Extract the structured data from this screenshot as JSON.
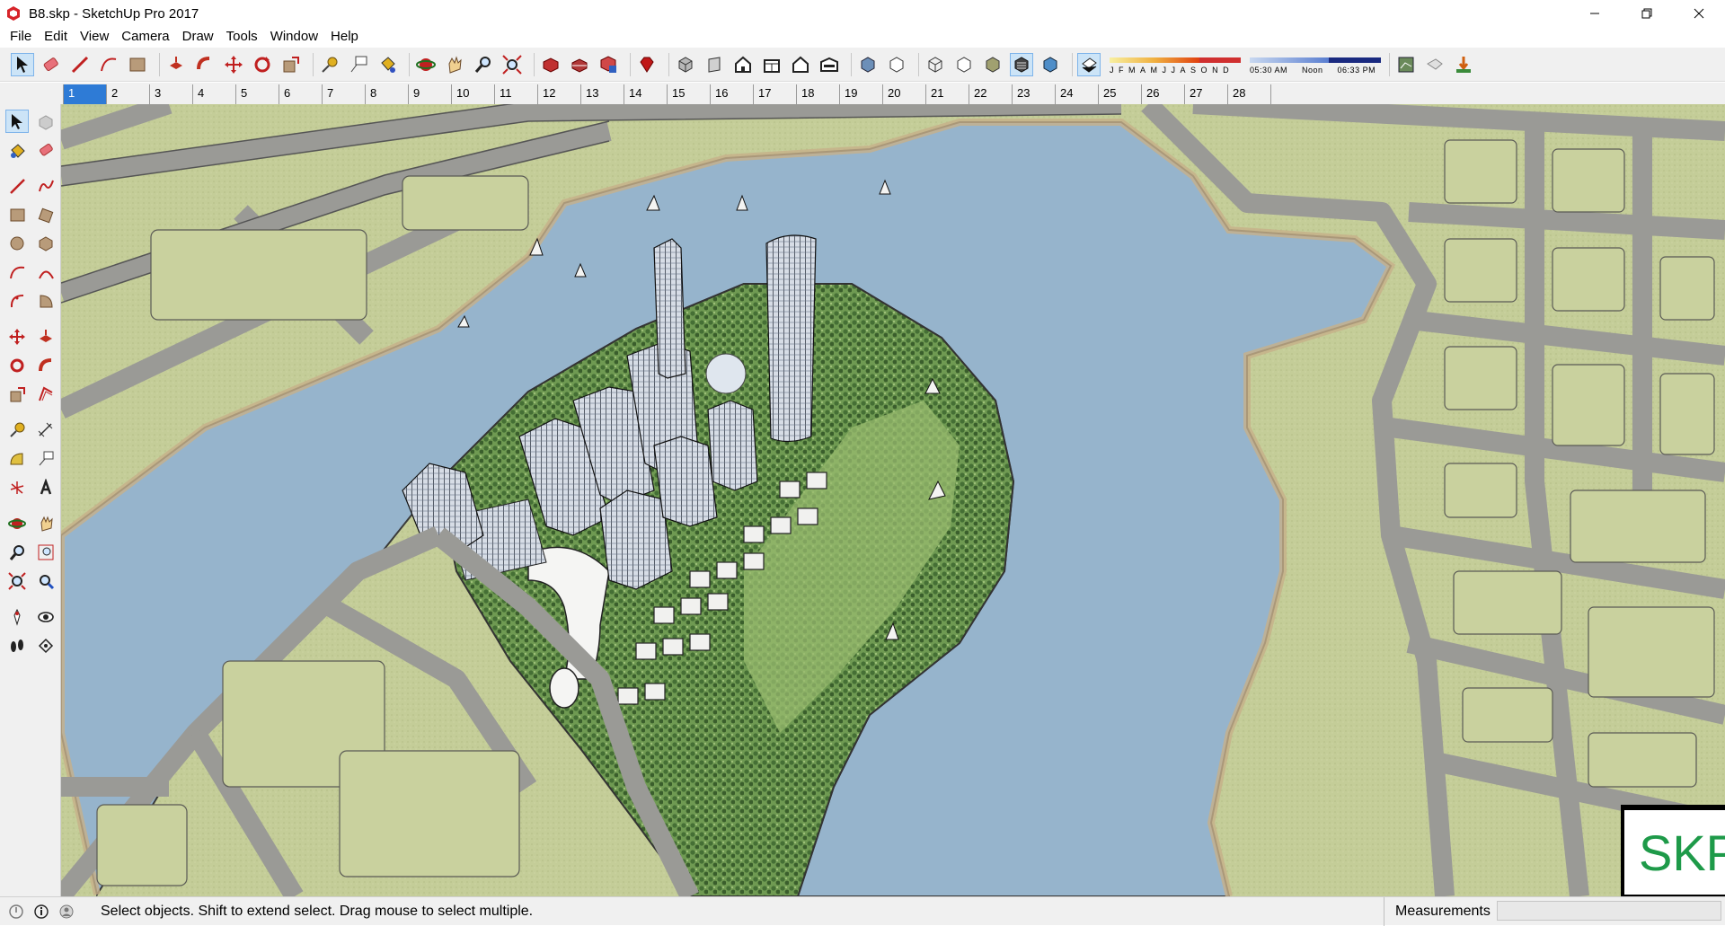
{
  "window": {
    "title": "B8.skp - SketchUp Pro 2017",
    "app_icon": "sketchup-icon",
    "controls": [
      "minimize-icon",
      "restore-icon",
      "close-icon"
    ]
  },
  "menu": [
    "File",
    "Edit",
    "View",
    "Camera",
    "Draw",
    "Tools",
    "Window",
    "Help"
  ],
  "toolbar": {
    "groups": [
      [
        "select-icon",
        "eraser-icon",
        "pencil-line-icon",
        "arc-icon",
        "rectangle-icon"
      ],
      [
        "push-pull-icon",
        "follow-me-icon",
        "move-icon",
        "rotate-icon",
        "scale-icon"
      ],
      [
        "tape-measure-icon",
        "text-icon",
        "paint-bucket-icon"
      ],
      [
        "orbit-icon",
        "pan-icon",
        "zoom-icon",
        "zoom-extents-icon"
      ],
      [
        "warehouse-icon",
        "share-model-icon",
        "extension-warehouse-icon"
      ],
      [
        "ruby-icon"
      ],
      [
        "iso-view-icon",
        "top-view-icon",
        "front-view-icon",
        "right-view-icon",
        "back-view-icon",
        "left-view-icon"
      ],
      [
        "xray-style-icon",
        "back-edges-icon",
        "wireframe-style-icon",
        "hidden-line-style-icon",
        "shaded-style-icon",
        "textured-style-icon",
        "monochrome-style-icon"
      ],
      [
        "shadows-toggle-icon"
      ]
    ],
    "shadow_months": [
      "J",
      "F",
      "M",
      "A",
      "M",
      "J",
      "J",
      "A",
      "S",
      "O",
      "N",
      "D"
    ],
    "shadow_time_start": "05:30 AM",
    "shadow_time_mid": "Noon",
    "shadow_time_end": "06:33 PM",
    "trailing": [
      "section-plane-icon",
      "section-display-icon",
      "add-location-icon"
    ]
  },
  "scenes": {
    "tabs": [
      "1",
      "2",
      "3",
      "4",
      "5",
      "6",
      "7",
      "8",
      "9",
      "10",
      "11",
      "12",
      "13",
      "14",
      "15",
      "16",
      "17",
      "18",
      "19",
      "20",
      "21",
      "22",
      "23",
      "24",
      "25",
      "26",
      "27",
      "28"
    ],
    "selected": "1"
  },
  "left_palette": [
    [
      "select-icon",
      "make-component-icon"
    ],
    [
      "paint-bucket-icon",
      "eraser-icon"
    ],
    [
      "line-icon",
      "freehand-icon"
    ],
    [
      "rectangle-icon",
      "rotated-rectangle-icon"
    ],
    [
      "circle-icon",
      "polygon-icon"
    ],
    [
      "arc-icon",
      "two-point-arc-icon"
    ],
    [
      "three-point-arc-icon",
      "pie-icon"
    ],
    [
      "move-icon",
      "push-pull-icon"
    ],
    [
      "rotate-icon",
      "follow-me-icon"
    ],
    [
      "scale-icon",
      "offset-icon"
    ],
    [
      "tape-measure-icon",
      "dimension-icon"
    ],
    [
      "protractor-icon",
      "text-icon"
    ],
    [
      "axes-icon",
      "3d-text-icon"
    ],
    [
      "orbit-icon",
      "pan-icon"
    ],
    [
      "zoom-icon",
      "zoom-window-icon"
    ],
    [
      "zoom-extents-icon",
      "previous-view-icon"
    ],
    [
      "position-camera-icon",
      "look-around-icon"
    ],
    [
      "walk-icon",
      "section-plane-icon"
    ]
  ],
  "viewport": {
    "description_icon": "city-model-canvas",
    "watermark": "SKP"
  },
  "statusbar": {
    "icons": [
      "geo-location-icon",
      "credits-icon",
      "user-account-icon"
    ],
    "message": "Select objects. Shift to extend select. Drag mouse to select multiple.",
    "measurements_label": "Measurements",
    "measurements_value": ""
  }
}
